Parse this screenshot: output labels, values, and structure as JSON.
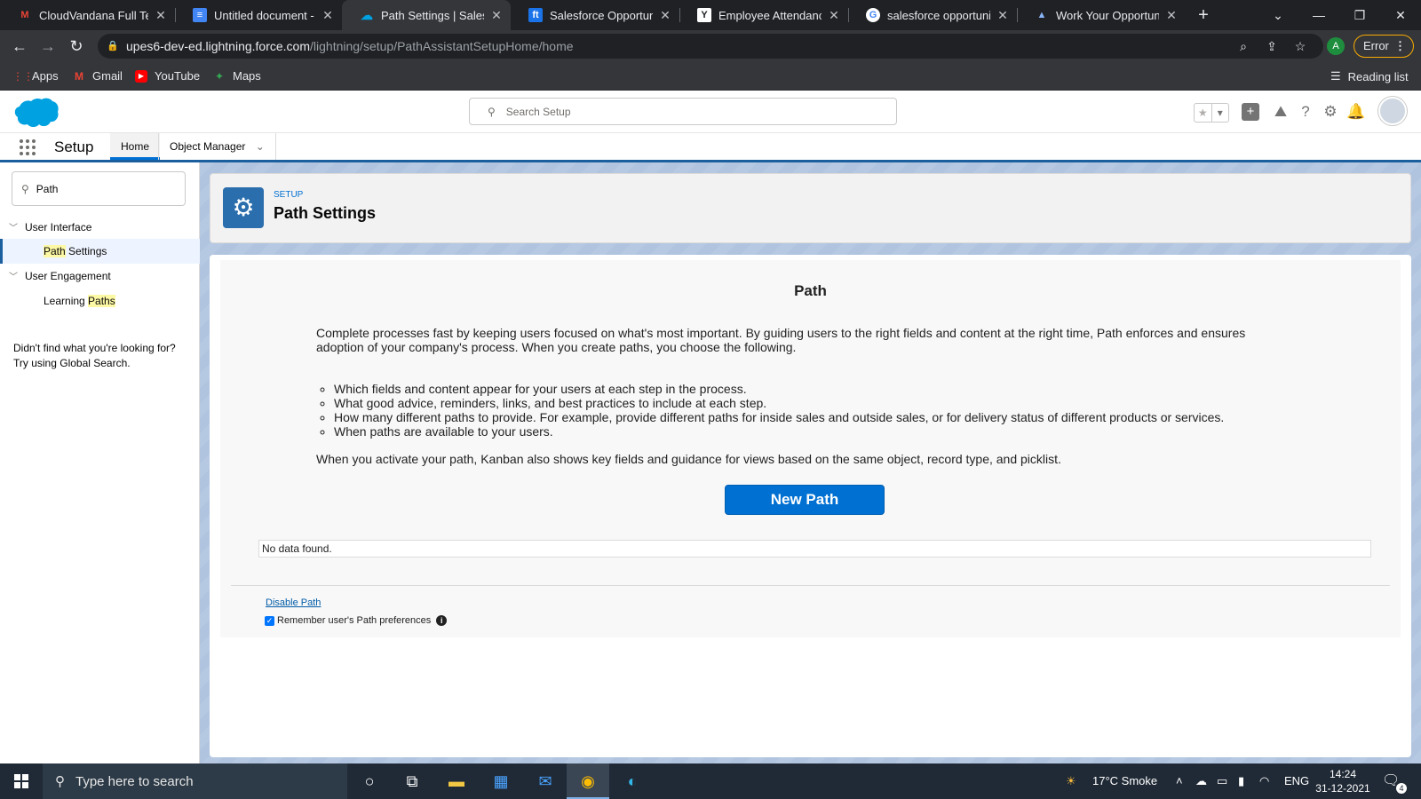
{
  "browser": {
    "tabs": [
      {
        "title": "CloudVandana Full Tean",
        "icon": "gmail-icon"
      },
      {
        "title": "Untitled document - Go",
        "icon": "docs-icon"
      },
      {
        "title": "Path Settings | Salesforc",
        "icon": "salesforce-icon"
      },
      {
        "title": "Salesforce Opportunity",
        "icon": "ft-icon"
      },
      {
        "title": "Employee Attendance L",
        "icon": "y-icon"
      },
      {
        "title": "salesforce opportunity",
        "icon": "google-icon"
      },
      {
        "title": "Work Your Opportuniti",
        "icon": "trailhead-icon"
      }
    ],
    "url_host": "upes6-dev-ed.lightning.force.com",
    "url_path": "/lightning/setup/PathAssistantSetupHome/home",
    "profile_initial": "A",
    "error_label": "Error",
    "bookmarks": [
      "Apps",
      "Gmail",
      "YouTube",
      "Maps"
    ],
    "reading_list": "Reading list"
  },
  "sf": {
    "search_placeholder": "Search Setup",
    "setup_label": "Setup",
    "nav_tabs": [
      "Home",
      "Object Manager"
    ],
    "quickfind_value": "Path",
    "tree": {
      "ui_parent": "User Interface",
      "path_settings": {
        "highlight": "Path",
        "rest": " Settings"
      },
      "engagement_parent": "User Engagement",
      "learning_paths": {
        "pre": "Learning ",
        "highlight": "Paths"
      }
    },
    "not_found": "Didn't find what you're looking for? Try using Global Search.",
    "breadcrumb": "SETUP",
    "page_title": "Path Settings"
  },
  "path": {
    "heading": "Path",
    "description": "Complete processes fast by keeping users focused on what's most important. By guiding users to the right fields and content at the right time, Path enforces and ensures adoption of your company's process. When you create paths, you choose the following.",
    "bullets": [
      "Which fields and content appear for your users at each step in the process.",
      "What good advice, reminders, links, and best practices to include at each step.",
      "How many different paths to provide. For example, provide different paths for inside sales and outside sales, or for delivery status of different products or services.",
      "When paths are available to your users."
    ],
    "kanban_note": "When you activate your path, Kanban also shows key fields and guidance for views based on the same object, record type, and picklist.",
    "new_path_button": "New Path",
    "no_data": "No data found.",
    "disable_link": "Disable Path",
    "remember_label": "Remember user's Path preferences",
    "remember_checked": true
  },
  "taskbar": {
    "search_placeholder": "Type here to search",
    "weather": "17°C  Smoke",
    "language": "ENG",
    "time": "14:24",
    "date": "31-12-2021",
    "notification_count": "4"
  },
  "colors": {
    "brand_blue": "#0070d2",
    "sf_nav_border": "#1b5f9e",
    "highlight": "#fcf8a4"
  }
}
